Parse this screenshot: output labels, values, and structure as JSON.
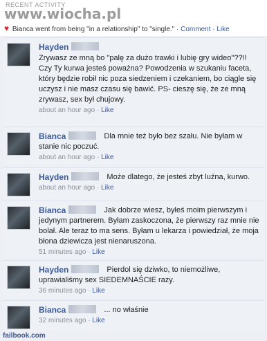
{
  "header": {
    "section_label": "RECENT ACTIVITY",
    "watermark": "www.wiocha.pl",
    "status_text": "Bianca went from being \"in a relationship\" to \"single.\"",
    "comment_link": "Comment",
    "like_link": "Like",
    "separator": " · "
  },
  "comments": [
    {
      "author": "Hayden",
      "text": "Zrywasz ze mną bo \"palę za dużo trawki i lubię gry wideo\"??!! Czy Ty kurwa jesteś poważna? Powodzenia w szukaniu faceta, który będzie robił nic poza siedzeniem i czekaniem, bo ciągle się uczysz i nie masz czasu się bawić. PS- cieszę się, że ze mną zrywasz, sex był chujowy.",
      "time": "about an hour ago",
      "like": "Like"
    },
    {
      "author": "Bianca",
      "text": "Dla mnie też było bez szału. Nie byłam w stanie nic poczuć.",
      "time": "about an hour ago",
      "like": "Like"
    },
    {
      "author": "Hayden",
      "text": "Może dlatego, że jesteś zbyt luźna, kurwo.",
      "time": "about an hour ago",
      "like": "Like"
    },
    {
      "author": "Bianca",
      "text": "Jak dobrze wiesz, byłeś moim pierwszym i jedynym partnerem. Byłam zaskoczona, że pierwszy raz mnie nie bolał. Ale teraz to ma sens. Byłam u lekarza i powiedział, że moja błona dziewicza jest nienaruszona.",
      "time": "51 minutes ago",
      "like": "Like"
    },
    {
      "author": "Hayden",
      "text": "Pierdol się dziwko, to niemożliwe, uprawialiśmy sex SIEDEMNAŚCIE razy.",
      "time": "36 minutes ago",
      "like": "Like"
    },
    {
      "author": "Bianca",
      "text": "... no właśnie",
      "time": "32 minutes ago",
      "like": "Like"
    }
  ],
  "footer": {
    "source": "failbook.com"
  },
  "colors": {
    "link": "#3b5998",
    "background": "#edeff4",
    "heart": "#d8273a"
  }
}
